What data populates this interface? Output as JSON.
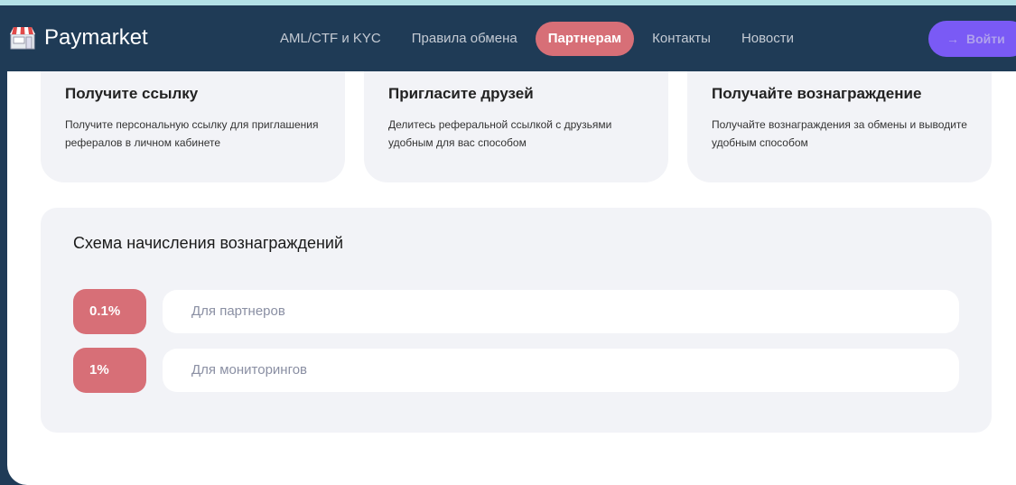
{
  "header": {
    "logo": "Paymarket",
    "nav": [
      {
        "label": "AML/CTF и KYC",
        "active": false
      },
      {
        "label": "Правила обмена",
        "active": false
      },
      {
        "label": "Партнерам",
        "active": true
      },
      {
        "label": "Контакты",
        "active": false
      },
      {
        "label": "Новости",
        "active": false
      }
    ],
    "login_label": "Войти",
    "login_icon": "sign-in-arrow-icon"
  },
  "steps": [
    {
      "title": "Получите ссылку",
      "text": "Получите персональную ссылку для приглашения рефералов в личном кабинете"
    },
    {
      "title": "Пригласите друзей",
      "text": "Делитесь реферальной ссылкой с друзьями удобным для вас способом"
    },
    {
      "title": "Получайте вознаграждение",
      "text": "Получайте вознаграждения за обмены и выводите удобным способом"
    }
  ],
  "scheme": {
    "title": "Схема начисления вознаграждений",
    "rows": [
      {
        "rate": "0.1%",
        "label": "Для партнеров"
      },
      {
        "rate": "1%",
        "label": "Для мониторингов"
      }
    ]
  },
  "colors": {
    "header": "#1f3b56",
    "accent": "#d76f77",
    "login": "#7a5af5"
  }
}
